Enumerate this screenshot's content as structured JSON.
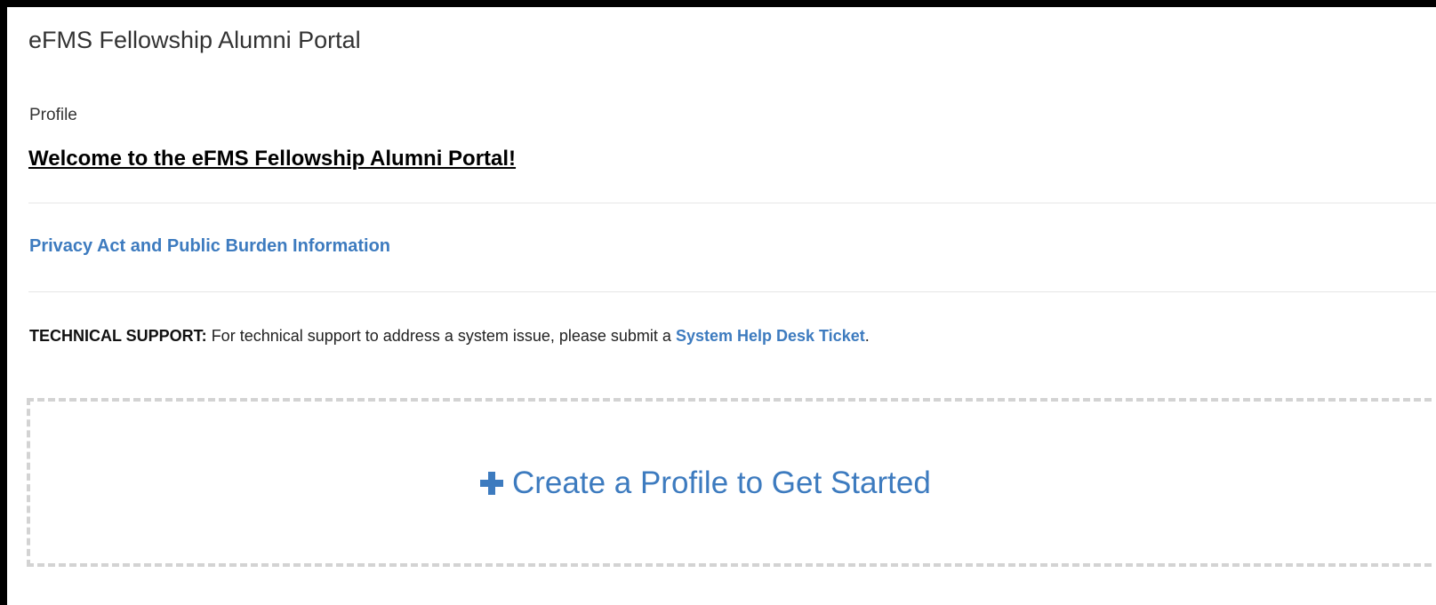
{
  "header": {
    "app_title": "eFMS Fellowship Alumni Portal"
  },
  "breadcrumb": {
    "current": "Profile"
  },
  "main": {
    "welcome_heading": "Welcome to the eFMS Fellowship Alumni Portal!",
    "privacy_link_label": "Privacy Act and Public Burden Information",
    "support": {
      "label": "TECHNICAL SUPPORT:",
      "text": " For technical support to address a system issue, please submit a ",
      "link_label": "System Help Desk Ticket",
      "suffix": "."
    },
    "create_profile": {
      "icon": "plus-icon",
      "label": "Create a Profile to Get Started"
    }
  },
  "colors": {
    "link": "#3d7bbf",
    "frame_border": "#000000",
    "dashed_border": "#d3d3d3",
    "divider": "#e6e6e6"
  }
}
